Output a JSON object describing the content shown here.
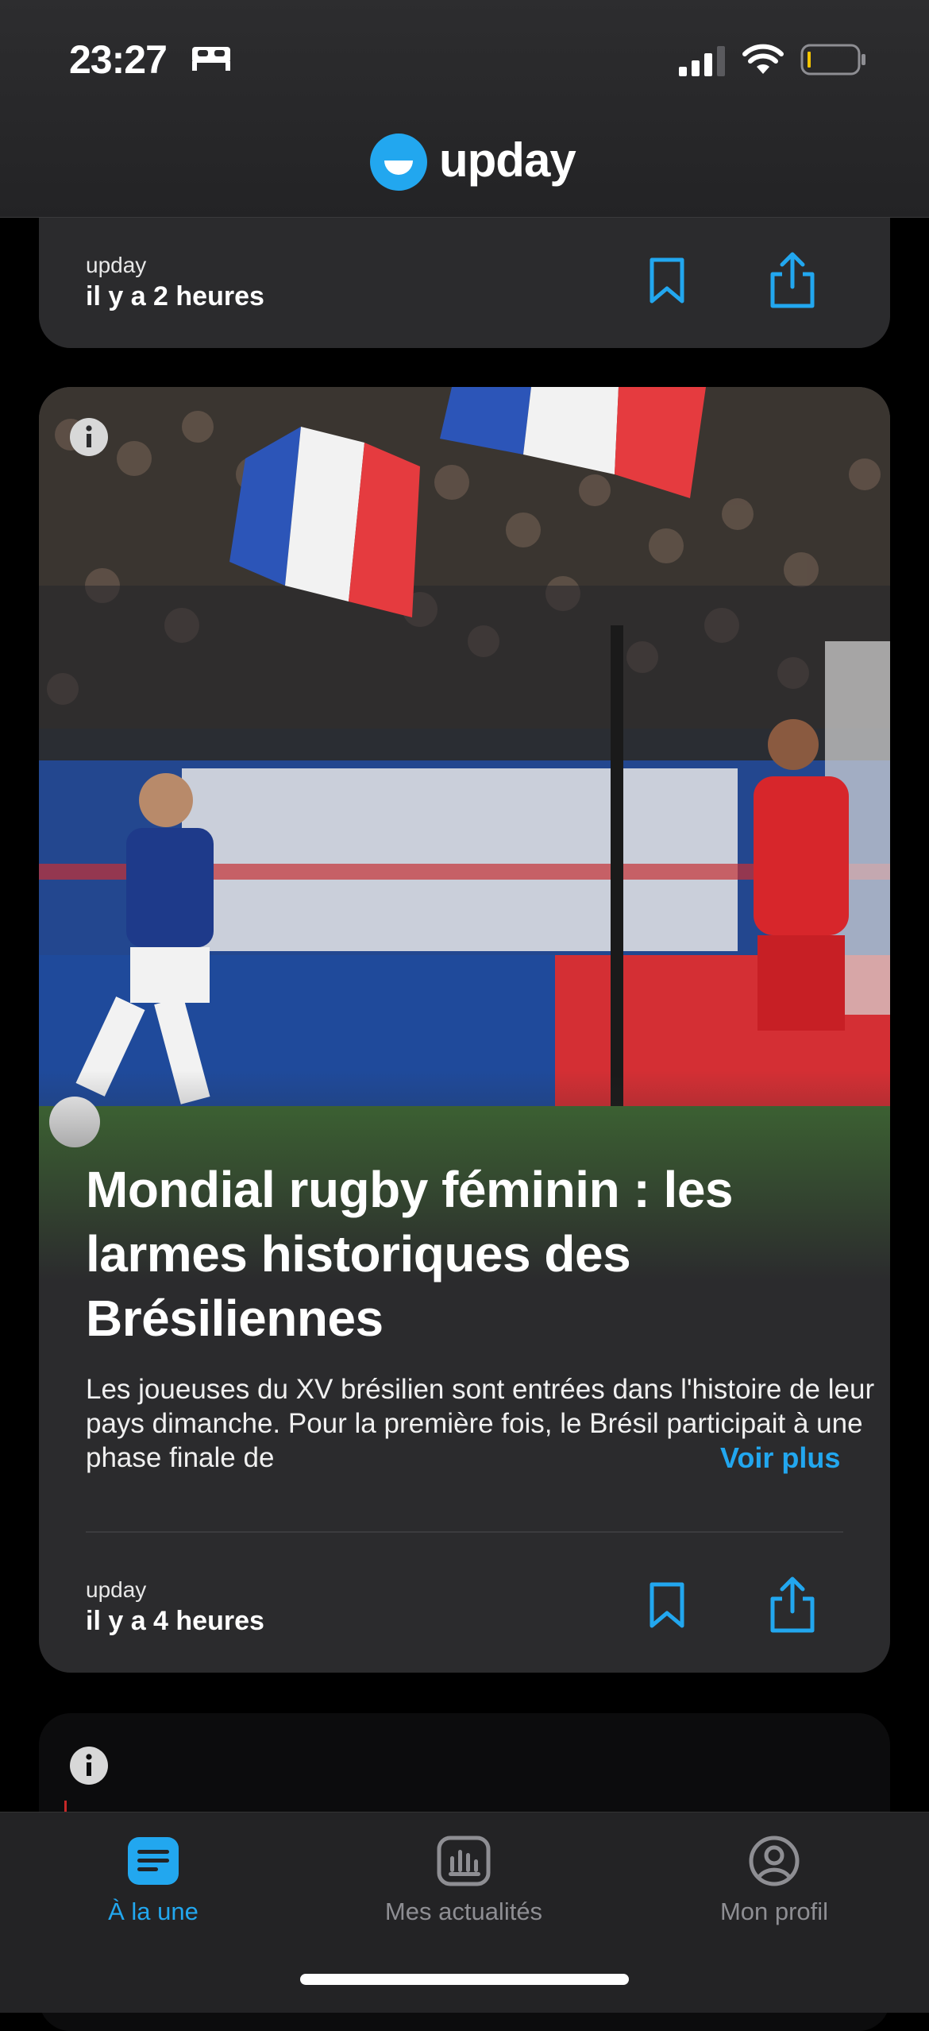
{
  "status_bar": {
    "time": "23:27",
    "icons": [
      "bed-icon",
      "signal-icon",
      "wifi-icon",
      "battery-icon"
    ]
  },
  "header": {
    "brand": "upday",
    "logo_icon": "upday-logo-icon",
    "accent_color": "#22a7ef"
  },
  "feed": [
    {
      "source": "upday",
      "age": "il y a 2 heures"
    },
    {
      "image_description": "football-match-photo",
      "headline": "Mondial rugby féminin : les larmes historiques des Brésiliennes",
      "summary": "Les joueuses du XV brésilien sont entrées dans l'histoire de leur pays dimanche. Pour la première fois, le Brésil participait à une phase finale de",
      "more_label": "Voir plus",
      "source": "upday",
      "age": "il y a 4 heures"
    }
  ],
  "tabbar": {
    "tabs": [
      {
        "label": "À la une",
        "icon": "news-icon",
        "active": true
      },
      {
        "label": "Mes actualités",
        "icon": "chart-icon",
        "active": false
      },
      {
        "label": "Mon profil",
        "icon": "profile-icon",
        "active": false
      }
    ]
  }
}
